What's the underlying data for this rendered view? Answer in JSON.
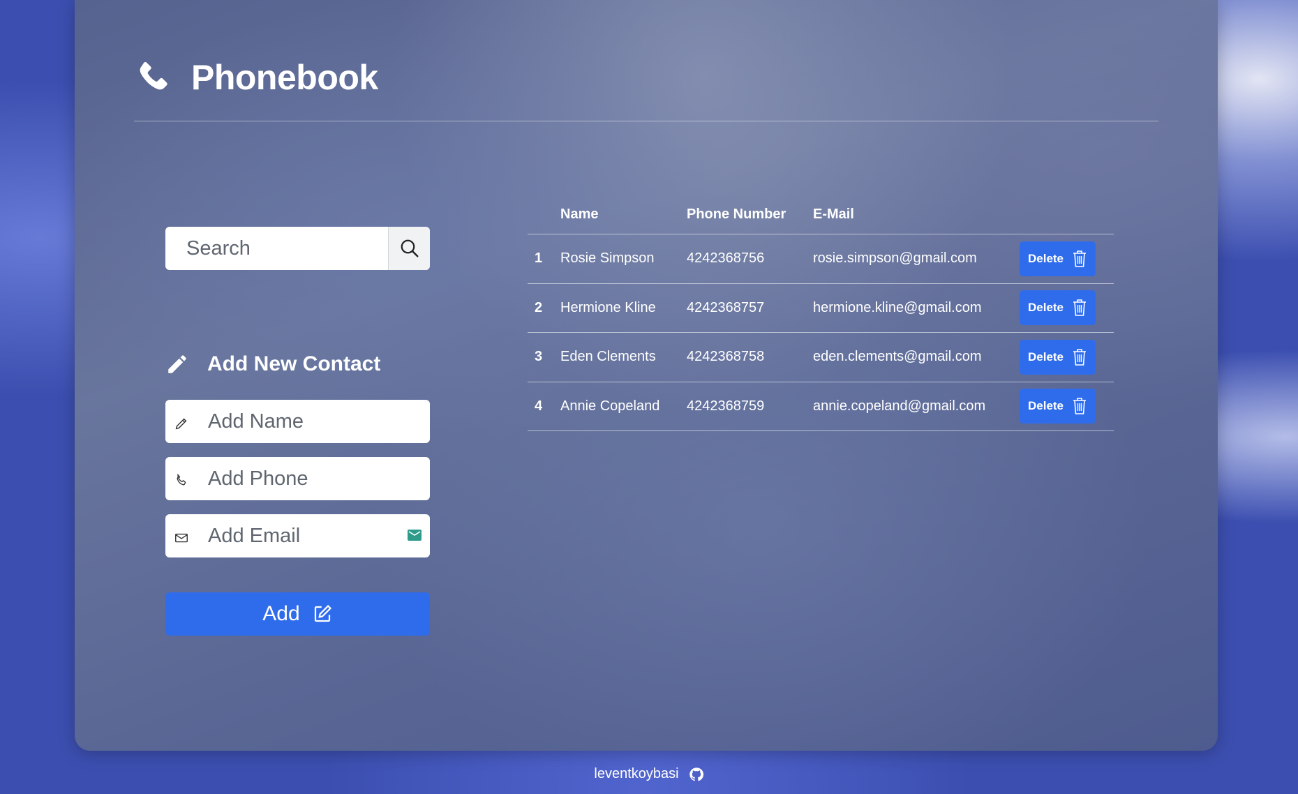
{
  "app": {
    "title": "Phonebook"
  },
  "search": {
    "placeholder": "Search"
  },
  "add_form": {
    "title": "Add New Contact",
    "name_placeholder": "Add Name",
    "phone_placeholder": "Add Phone",
    "email_placeholder": "Add Email",
    "submit_label": "Add"
  },
  "table": {
    "headers": {
      "index": "",
      "name": "Name",
      "phone": "Phone Number",
      "email": "E-Mail"
    },
    "delete_label": "Delete",
    "rows": [
      {
        "index": "1",
        "name": "Rosie Simpson",
        "phone": "4242368756",
        "email": "rosie.simpson@gmail.com"
      },
      {
        "index": "2",
        "name": "Hermione Kline",
        "phone": "4242368757",
        "email": "hermione.kline@gmail.com"
      },
      {
        "index": "3",
        "name": "Eden Clements",
        "phone": "4242368758",
        "email": "eden.clements@gmail.com"
      },
      {
        "index": "4",
        "name": "Annie Copeland",
        "phone": "4242368759",
        "email": "annie.copeland@gmail.com"
      }
    ]
  },
  "footer": {
    "author": "leventkoybasi"
  },
  "colors": {
    "accent": "#2f6cec",
    "text": "#ffffff",
    "field_text": "#5f6670"
  },
  "icons": [
    "phone-icon",
    "search-icon",
    "pencil-icon",
    "edit-icon",
    "mail-icon",
    "trash-icon",
    "github-icon"
  ]
}
